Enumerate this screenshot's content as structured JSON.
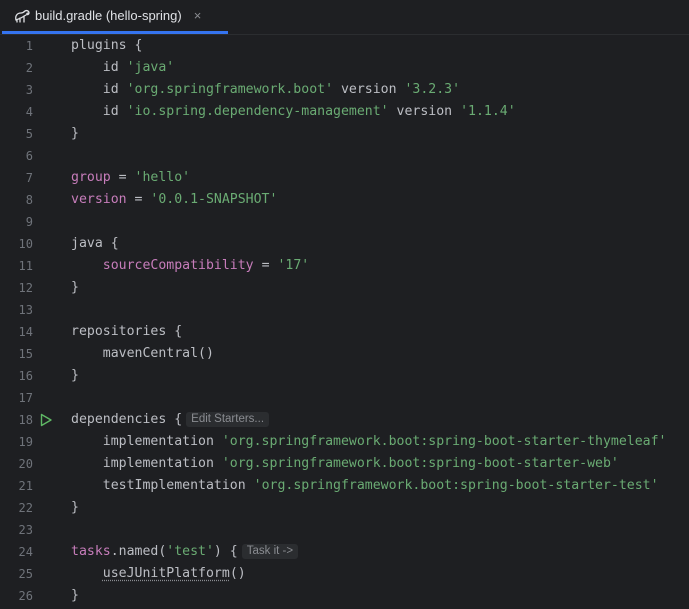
{
  "tab": {
    "title": "build.gradle (hello-spring)",
    "close_glyph": "×",
    "icon": "gradle-elephant-icon"
  },
  "colors": {
    "background": "#1e1f22",
    "accent": "#3574f0",
    "string": "#6aab73",
    "property": "#c77dbb",
    "text": "#bcbec4",
    "line_number": "#6f737a"
  },
  "code": {
    "lines": [
      {
        "n": "1",
        "parts": [
          [
            "plugins {",
            ""
          ]
        ]
      },
      {
        "n": "2",
        "parts": [
          [
            "    id ",
            ""
          ],
          [
            "'java'",
            "str"
          ]
        ]
      },
      {
        "n": "3",
        "parts": [
          [
            "    id ",
            ""
          ],
          [
            "'org.springframework.boot'",
            "str"
          ],
          [
            " version ",
            ""
          ],
          [
            "'3.2.3'",
            "str"
          ]
        ]
      },
      {
        "n": "4",
        "parts": [
          [
            "    id ",
            ""
          ],
          [
            "'io.spring.dependency-management'",
            "str"
          ],
          [
            " version ",
            ""
          ],
          [
            "'1.1.4'",
            "str"
          ]
        ]
      },
      {
        "n": "5",
        "parts": [
          [
            "}",
            ""
          ]
        ]
      },
      {
        "n": "6",
        "parts": []
      },
      {
        "n": "7",
        "parts": [
          [
            "group",
            "kw"
          ],
          [
            " = ",
            ""
          ],
          [
            "'hello'",
            "str"
          ]
        ]
      },
      {
        "n": "8",
        "parts": [
          [
            "version",
            "kw"
          ],
          [
            " = ",
            ""
          ],
          [
            "'0.0.1-SNAPSHOT'",
            "str"
          ]
        ]
      },
      {
        "n": "9",
        "parts": []
      },
      {
        "n": "10",
        "parts": [
          [
            "java {",
            ""
          ]
        ]
      },
      {
        "n": "11",
        "parts": [
          [
            "    ",
            ""
          ],
          [
            "sourceCompatibility",
            "kw"
          ],
          [
            " = ",
            ""
          ],
          [
            "'17'",
            "str"
          ]
        ]
      },
      {
        "n": "12",
        "parts": [
          [
            "}",
            ""
          ]
        ]
      },
      {
        "n": "13",
        "parts": []
      },
      {
        "n": "14",
        "parts": [
          [
            "repositories {",
            ""
          ]
        ]
      },
      {
        "n": "15",
        "parts": [
          [
            "    mavenCentral()",
            ""
          ]
        ]
      },
      {
        "n": "16",
        "parts": [
          [
            "}",
            ""
          ]
        ]
      },
      {
        "n": "17",
        "parts": []
      },
      {
        "n": "18",
        "parts": [
          [
            "dependencies {",
            ""
          ]
        ],
        "hint": "Edit Starters...",
        "run": true
      },
      {
        "n": "19",
        "parts": [
          [
            "    implementation ",
            ""
          ],
          [
            "'org.springframework.boot:spring-boot-starter-thymeleaf'",
            "str"
          ]
        ]
      },
      {
        "n": "20",
        "parts": [
          [
            "    implementation ",
            ""
          ],
          [
            "'org.springframework.boot:spring-boot-starter-web'",
            "str"
          ]
        ]
      },
      {
        "n": "21",
        "parts": [
          [
            "    testImplementation ",
            ""
          ],
          [
            "'org.springframework.boot:spring-boot-starter-test'",
            "str"
          ]
        ]
      },
      {
        "n": "22",
        "parts": [
          [
            "}",
            ""
          ]
        ]
      },
      {
        "n": "23",
        "parts": []
      },
      {
        "n": "24",
        "parts": [
          [
            "tasks",
            "kw"
          ],
          [
            ".named(",
            ""
          ],
          [
            "'test'",
            "str"
          ],
          [
            ") {",
            ""
          ]
        ],
        "hint": "Task it ->"
      },
      {
        "n": "25",
        "parts": [
          [
            "    ",
            ""
          ],
          [
            "useJUnitPlatform",
            "dotted"
          ],
          [
            "()",
            ""
          ]
        ]
      },
      {
        "n": "26",
        "parts": [
          [
            "}",
            ""
          ]
        ]
      }
    ]
  }
}
